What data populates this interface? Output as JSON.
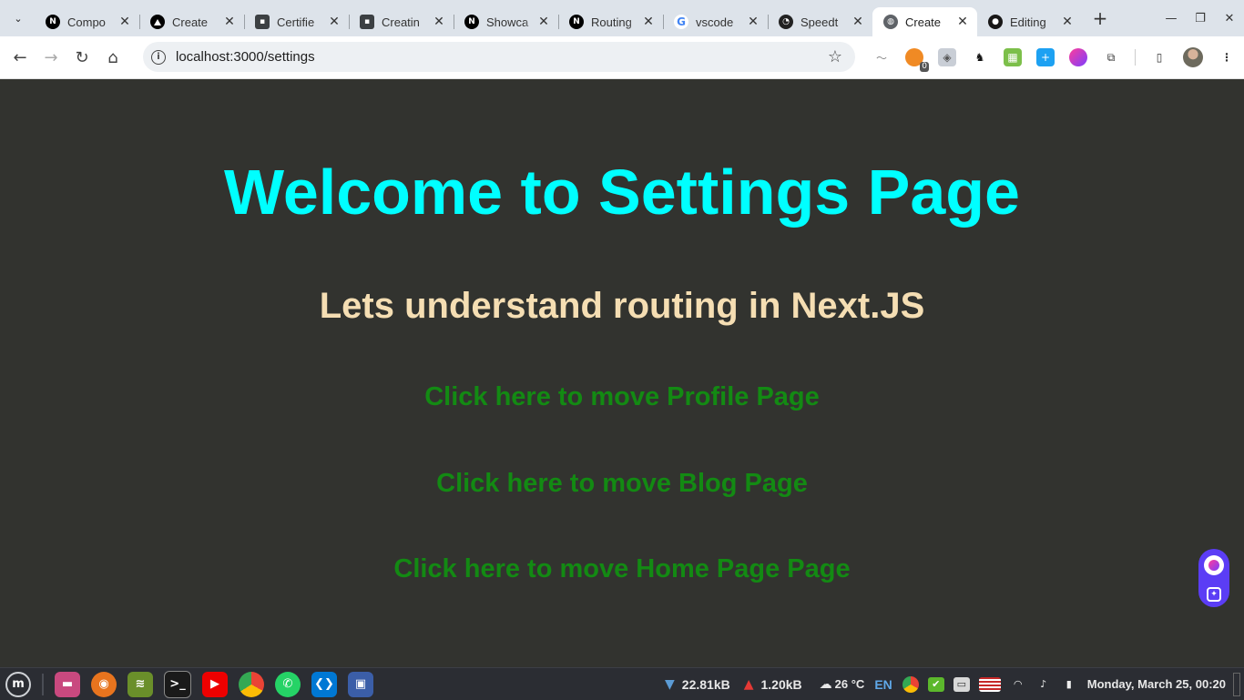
{
  "browser": {
    "tabs": [
      {
        "title": "Compo",
        "favicon": "nextjs-icon",
        "active": false
      },
      {
        "title": "Create",
        "favicon": "vercel-icon",
        "active": false
      },
      {
        "title": "Certifie",
        "favicon": "card-icon",
        "active": false
      },
      {
        "title": "Creatin",
        "favicon": "card-icon",
        "active": false
      },
      {
        "title": "Showca",
        "favicon": "nextjs-icon",
        "active": false
      },
      {
        "title": "Routing",
        "favicon": "nextjs-icon",
        "active": false
      },
      {
        "title": "vscode",
        "favicon": "google-icon",
        "active": false
      },
      {
        "title": "Speedt",
        "favicon": "speedtest-icon",
        "active": false
      },
      {
        "title": "Create",
        "favicon": "globe-icon",
        "active": true
      },
      {
        "title": "Editing",
        "favicon": "github-icon",
        "active": false
      }
    ],
    "address": {
      "url": "localhost:3000/settings"
    },
    "extension_badge": "0"
  },
  "page": {
    "heading": "Welcome to Settings Page",
    "subheading": "Lets understand routing in Next.JS",
    "links": [
      "Click here to move Profile Page",
      "Click here to move Blog Page",
      "Click here to move Home Page Page"
    ],
    "colors": {
      "background": "#32332f",
      "heading": "#00ffff",
      "subheading": "#f5deb3",
      "link": "#138a13"
    }
  },
  "taskbar": {
    "download_speed": "22.81kB",
    "upload_speed": "1.20kB",
    "weather": "26 °C",
    "language": "EN",
    "clock": "Monday, March 25, 00:20"
  }
}
